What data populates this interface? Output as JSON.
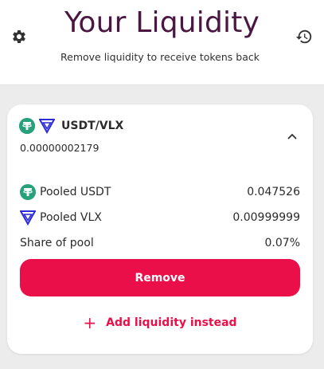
{
  "header": {
    "title": "Your Liquidity",
    "subtitle": "Remove liquidity to receive tokens back",
    "settings_icon": "gear-icon",
    "history_icon": "history-icon"
  },
  "position": {
    "pair": "USDT/VLX",
    "amount": "0.00000002179",
    "expanded": true,
    "details": [
      {
        "icon": "usdt-token-icon",
        "label": "Pooled USDT",
        "value": "0.047526"
      },
      {
        "icon": "vlx-token-icon",
        "label": "Pooled VLX",
        "value": "0.00999999"
      },
      {
        "label": "Share of pool",
        "value": "0.07%"
      }
    ],
    "remove_label": "Remove",
    "add_label": "Add liquidity instead"
  },
  "colors": {
    "accent": "#ea0f48",
    "title": "#4a1642",
    "usdt": "#26a17b",
    "vlx": "#2a2ad6"
  }
}
